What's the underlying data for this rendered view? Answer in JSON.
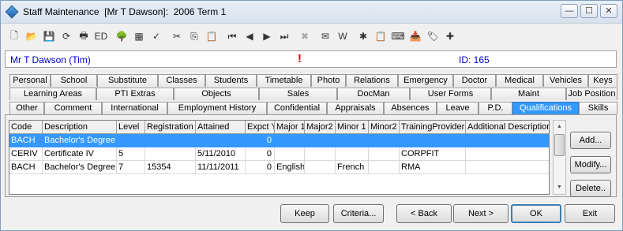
{
  "window": {
    "title": "Staff Maintenance  [Mr T Dawson]:  2006 Term 1",
    "minimize_glyph": "—",
    "maximize_glyph": "☐",
    "close_glyph": "✕"
  },
  "toolbar": {
    "icons": [
      {
        "name": "new-document-icon",
        "glyph": "🗋"
      },
      {
        "name": "open-folder-icon",
        "glyph": "📂"
      },
      {
        "name": "save-icon",
        "glyph": "💾",
        "disabled": true
      },
      {
        "name": "refresh-icon",
        "glyph": "⟳"
      },
      {
        "name": "print-icon",
        "glyph": "🖶"
      },
      {
        "name": "edit-id-icon",
        "glyph": "ED"
      },
      {
        "name": "tree-icon",
        "glyph": "🌳"
      },
      {
        "name": "calculator-icon",
        "glyph": "▦"
      },
      {
        "name": "spellcheck-icon",
        "glyph": "✓"
      },
      {
        "name": "cut-icon",
        "glyph": "✂"
      },
      {
        "name": "copy-icon",
        "glyph": "⎘"
      },
      {
        "name": "paste-icon",
        "glyph": "📋"
      },
      {
        "name": "first-record-icon",
        "glyph": "⏮"
      },
      {
        "name": "previous-record-icon",
        "glyph": "◀"
      },
      {
        "name": "next-record-icon",
        "glyph": "▶"
      },
      {
        "name": "last-record-icon",
        "glyph": "⏭"
      },
      {
        "name": "delete-icon",
        "glyph": "✖",
        "disabled": true
      },
      {
        "name": "mail-icon",
        "glyph": "✉"
      },
      {
        "name": "word-icon",
        "glyph": "W"
      },
      {
        "name": "tools-icon",
        "glyph": "✱"
      },
      {
        "name": "clipboard-icon",
        "glyph": "📋"
      },
      {
        "name": "keyboard-icon",
        "glyph": "⌨"
      },
      {
        "name": "inbox-icon",
        "glyph": "📥"
      },
      {
        "name": "tag-icon",
        "glyph": "🏷"
      },
      {
        "name": "add-icon",
        "glyph": "✚"
      }
    ]
  },
  "infobar": {
    "name": "Mr T Dawson (Tim)",
    "alert": "!",
    "id": "ID: 165"
  },
  "tabs": {
    "row1": [
      "Personal",
      "School",
      "Substitute",
      "Classes",
      "Students",
      "Timetable",
      "Photo",
      "Relations",
      "Emergency",
      "Doctor",
      "Medical",
      "Vehicles",
      "Keys"
    ],
    "row2": [
      "Learning Areas",
      "PTI Extras",
      "Objects",
      "Sales",
      "DocMan",
      "User Forms",
      "Maint",
      "Job Position"
    ],
    "row3": [
      "Other",
      "Comment",
      "International",
      "Employment History",
      "Confidential",
      "Appraisals",
      "Absences",
      "Leave",
      "P.D.",
      "Qualifications",
      "Skills"
    ],
    "active": "Qualifications"
  },
  "grid": {
    "columns": [
      "Code",
      "Description",
      "Level",
      "Registration",
      "Attained",
      "Expct Yr",
      "Major 1",
      "Major2",
      "Minor 1",
      "Minor2",
      "TrainingProvider",
      "Additional Description"
    ],
    "rows": [
      [
        "BACH",
        "Bachelor's Degree",
        "",
        "",
        "",
        "0",
        "",
        "",
        "",
        "",
        "",
        ""
      ],
      [
        "CERIV",
        "Certificate IV",
        "5",
        "",
        "5/11/2010",
        "0",
        "",
        "",
        "",
        "",
        "CORPFIT",
        ""
      ],
      [
        "BACH",
        "Bachelor's Degree",
        "7",
        "15354",
        "11/11/2011",
        "0",
        "English",
        "",
        "French",
        "",
        "RMA",
        ""
      ]
    ],
    "selected_row": 0
  },
  "side_buttons": {
    "add": "Add...",
    "modify": "Modify...",
    "delete": "Delete.."
  },
  "bottom_buttons": {
    "keep": "Keep",
    "criteria": "Criteria...",
    "back": "< Back",
    "next": "Next >",
    "ok": "OK",
    "exit": "Exit"
  }
}
